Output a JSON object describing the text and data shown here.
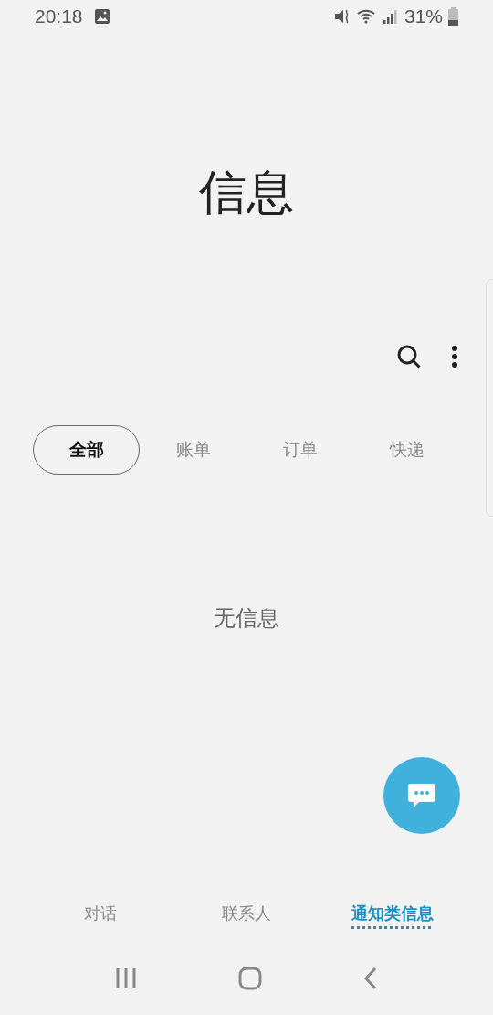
{
  "status_bar": {
    "time": "20:18",
    "battery": "31%"
  },
  "title": "信息",
  "filters": [
    {
      "label": "全部",
      "selected": true
    },
    {
      "label": "账单",
      "selected": false
    },
    {
      "label": "订单",
      "selected": false
    },
    {
      "label": "快递",
      "selected": false
    }
  ],
  "empty_message": "无信息",
  "bottom_tabs": [
    {
      "label": "对话",
      "selected": false
    },
    {
      "label": "联系人",
      "selected": false
    },
    {
      "label": "通知类信息",
      "selected": true
    }
  ]
}
